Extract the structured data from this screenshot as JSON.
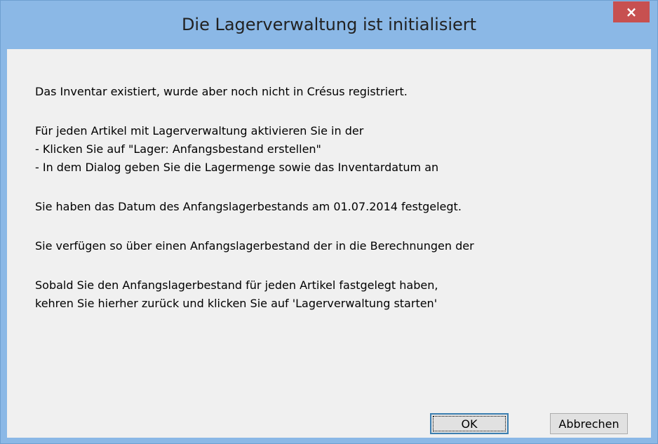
{
  "window": {
    "title": "Die Lagerverwaltung ist initialisiert",
    "close_icon": "close-icon",
    "close_label": "×",
    "titlebar_color": "#8bb8e6",
    "close_color": "#c75050"
  },
  "message": {
    "p1": "Das Inventar existiert, wurde aber noch nicht in Crésus registriert.",
    "p2_l1": "Für jeden Artikel mit Lagerverwaltung aktivieren Sie in der",
    "p2_l2": "- Klicken Sie auf \"Lager: Anfangsbestand erstellen\"",
    "p2_l3": "- In dem Dialog geben Sie die Lagermenge sowie das Inventardatum an",
    "p3": "Sie haben das Datum des Anfangslagerbestands am 01.07.2014 festgelegt.",
    "p4": "Sie verfügen so über einen Anfangslagerbestand der in die Berechnungen der",
    "p5_l1": "Sobald Sie den Anfangslagerbestand für jeden Artikel fastgelegt haben,",
    "p5_l2": "kehren Sie hierher zurück und klicken Sie auf 'Lagerverwaltung starten'"
  },
  "buttons": {
    "ok": "OK",
    "cancel": "Abbrechen"
  }
}
